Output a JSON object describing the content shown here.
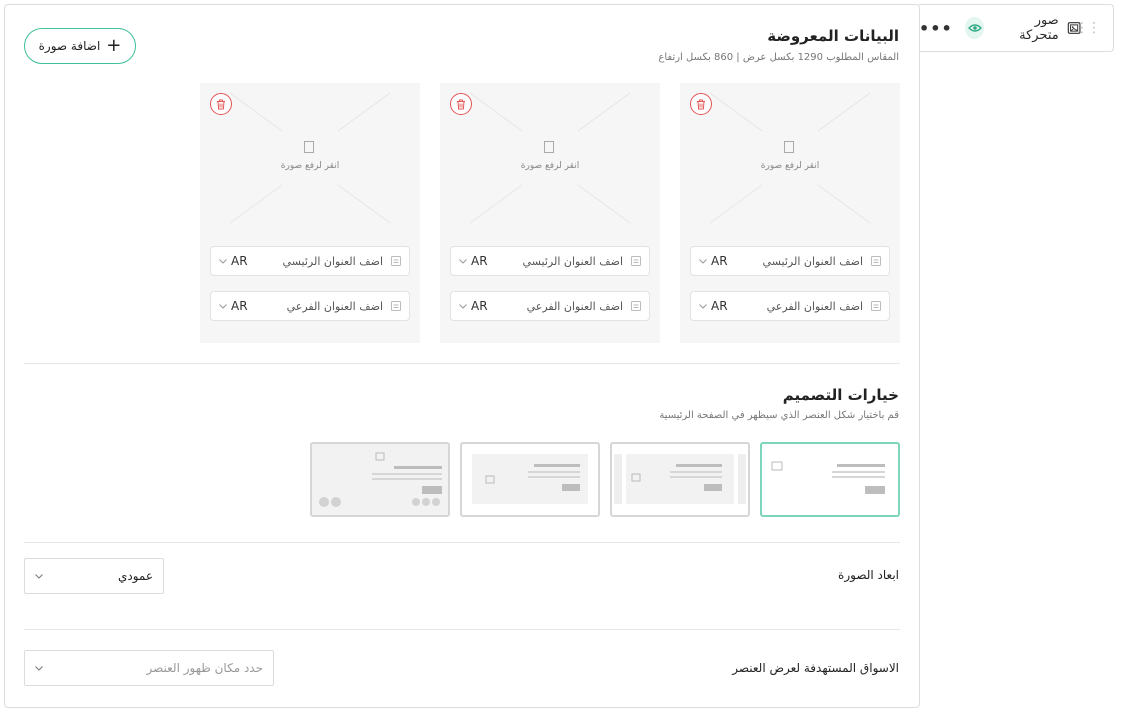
{
  "element_tab": {
    "title": "صور متحركة",
    "more": "•••",
    "drag": "⋮⋮"
  },
  "displayed_data": {
    "title": "البيانات المعروضة",
    "subtitle": "المقاس المطلوب 1290 بكسل عرض | 860 بكسل ارتفاع",
    "add_button": "اضافة صورة"
  },
  "cards": [
    {
      "upload_label": "انقر لرفع صورة",
      "main_title_placeholder": "اضف العنوان الرئيسي",
      "sub_title_placeholder": "اضف العنوان الفرعي",
      "lang_main": "AR",
      "lang_sub": "AR"
    },
    {
      "upload_label": "انقر لرفع صورة",
      "main_title_placeholder": "اضف العنوان الرئيسي",
      "sub_title_placeholder": "اضف العنوان الفرعي",
      "lang_main": "AR",
      "lang_sub": "AR"
    },
    {
      "upload_label": "انقر لرفع صورة",
      "main_title_placeholder": "اضف العنوان الرئيسي",
      "sub_title_placeholder": "اضف العنوان الفرعي",
      "lang_main": "AR",
      "lang_sub": "AR"
    }
  ],
  "design_options": {
    "title": "خيارات التصميم",
    "subtitle": "قم باختيار شكل العنصر الذي سيظهر في الصفحة الرئيسية",
    "selected_index": 0
  },
  "image_dimensions": {
    "label": "ابعاد الصورة",
    "value": "عمودي"
  },
  "target_markets": {
    "label": "الاسواق المستهدفة لعرض العنصر",
    "placeholder": "حدد مكان ظهور العنصر"
  },
  "colors": {
    "accent": "#3fbf9b",
    "danger": "#e25555",
    "card_bg": "#f6f6f6"
  }
}
